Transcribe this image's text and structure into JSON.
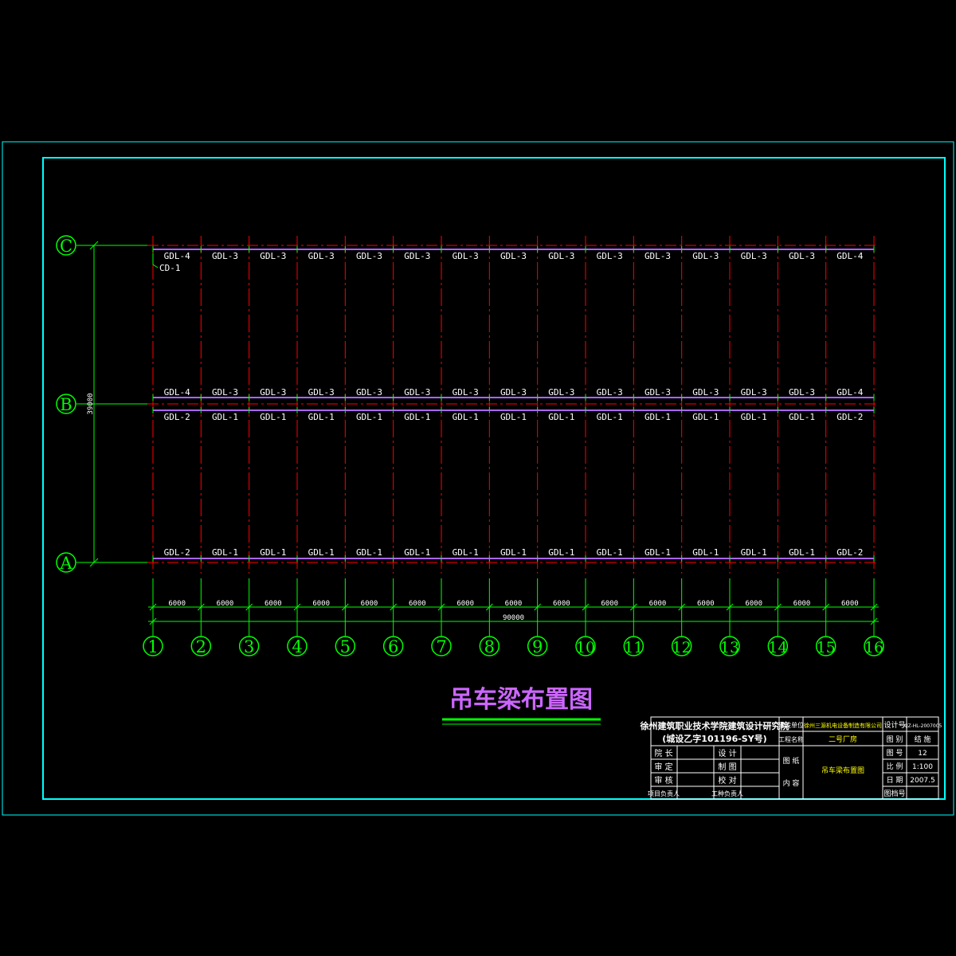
{
  "drawing_title": "吊车梁布置图",
  "axes": {
    "rows": [
      "C",
      "B",
      "A"
    ],
    "columns": [
      "1",
      "2",
      "3",
      "4",
      "5",
      "6",
      "7",
      "8",
      "9",
      "10",
      "11",
      "12",
      "13",
      "14",
      "15",
      "16"
    ]
  },
  "dimensions": {
    "bay": "6000",
    "total": "90000",
    "vertical": "39000"
  },
  "callout": "CD-1",
  "beam_rows": {
    "C_top": [
      "GDL-4",
      "GDL-3",
      "GDL-3",
      "GDL-3",
      "GDL-3",
      "GDL-3",
      "GDL-3",
      "GDL-3",
      "GDL-3",
      "GDL-3",
      "GDL-3",
      "GDL-3",
      "GDL-3",
      "GDL-3",
      "GDL-4"
    ],
    "B_top": [
      "GDL-4",
      "GDL-3",
      "GDL-3",
      "GDL-3",
      "GDL-3",
      "GDL-3",
      "GDL-3",
      "GDL-3",
      "GDL-3",
      "GDL-3",
      "GDL-3",
      "GDL-3",
      "GDL-3",
      "GDL-3",
      "GDL-4"
    ],
    "B_bottom": [
      "GDL-2",
      "GDL-1",
      "GDL-1",
      "GDL-1",
      "GDL-1",
      "GDL-1",
      "GDL-1",
      "GDL-1",
      "GDL-1",
      "GDL-1",
      "GDL-1",
      "GDL-1",
      "GDL-1",
      "GDL-1",
      "GDL-2"
    ],
    "A_top": [
      "GDL-2",
      "GDL-1",
      "GDL-1",
      "GDL-1",
      "GDL-1",
      "GDL-1",
      "GDL-1",
      "GDL-1",
      "GDL-1",
      "GDL-1",
      "GDL-1",
      "GDL-1",
      "GDL-1",
      "GDL-1",
      "GDL-2"
    ]
  },
  "title_block": {
    "institute_line1": "徐州建筑职业技术学院建筑设计研究院",
    "institute_line2": "(城设乙字101196-SY号)",
    "roles": [
      [
        "院 长",
        "设 计"
      ],
      [
        "审 定",
        "制 图"
      ],
      [
        "审 核",
        "校 对"
      ],
      [
        "项目负责人",
        "工种负责人"
      ]
    ],
    "client_label": "建设单位",
    "client_value": "徐州三源机电设备制造有限公司",
    "project_label": "工程名称",
    "project_value": "二号厂房",
    "content_label_1": "图 纸",
    "content_label_2": "内 容",
    "content_value": "吊车梁布置图",
    "design_no_label": "设计号",
    "design_no_value": "XJZ-HL-2007005",
    "category_label": "图 别",
    "category_value": "结 施",
    "sheet_label": "图 号",
    "sheet_value": "12",
    "scale_label": "比 例",
    "scale_value": "1:100",
    "date_label": "日 期",
    "date_value": "2007.5",
    "sheet_no_label": "图档号",
    "sheet_no_value": ""
  },
  "colors": {
    "background": "#000000",
    "frame": "#00ffff",
    "axis": "#00ff00",
    "grid": "#ff0000",
    "beam": "#aa66ff",
    "text": "#ffffff",
    "title": "#cc66ff",
    "yellow": "#ffff00"
  }
}
